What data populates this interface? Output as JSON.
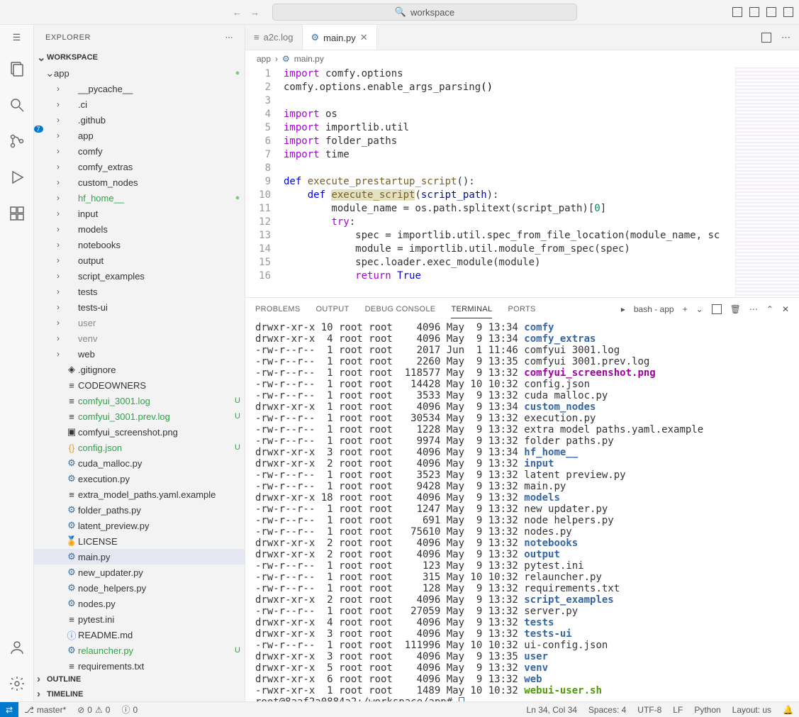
{
  "title": {
    "search_placeholder": "workspace"
  },
  "activity": {
    "badge_scc": "7"
  },
  "sidebar": {
    "title": "EXPLORER",
    "workspace": "WORKSPACE",
    "outline": "OUTLINE",
    "timeline": "TIMELINE",
    "root": "app",
    "items": [
      {
        "type": "folder",
        "name": "__pycache__",
        "indent": 2
      },
      {
        "type": "folder",
        "name": ".ci",
        "indent": 2
      },
      {
        "type": "folder",
        "name": ".github",
        "indent": 2
      },
      {
        "type": "folder",
        "name": "app",
        "indent": 2
      },
      {
        "type": "folder",
        "name": "comfy",
        "indent": 2
      },
      {
        "type": "folder",
        "name": "comfy_extras",
        "indent": 2
      },
      {
        "type": "folder",
        "name": "custom_nodes",
        "indent": 2
      },
      {
        "type": "folder",
        "name": "hf_home__",
        "indent": 2,
        "color": "green",
        "dot": true
      },
      {
        "type": "folder",
        "name": "input",
        "indent": 2
      },
      {
        "type": "folder",
        "name": "models",
        "indent": 2
      },
      {
        "type": "folder",
        "name": "notebooks",
        "indent": 2
      },
      {
        "type": "folder",
        "name": "output",
        "indent": 2
      },
      {
        "type": "folder",
        "name": "script_examples",
        "indent": 2
      },
      {
        "type": "folder",
        "name": "tests",
        "indent": 2
      },
      {
        "type": "folder",
        "name": "tests-ui",
        "indent": 2
      },
      {
        "type": "folder",
        "name": "user",
        "indent": 2,
        "grey": true
      },
      {
        "type": "folder",
        "name": "venv",
        "indent": 2,
        "grey": true
      },
      {
        "type": "folder",
        "name": "web",
        "indent": 2
      },
      {
        "type": "file",
        "name": ".gitignore",
        "indent": 2,
        "icon": "◈"
      },
      {
        "type": "file",
        "name": "CODEOWNERS",
        "indent": 2,
        "icon": "≡"
      },
      {
        "type": "file",
        "name": "comfyui_3001.log",
        "indent": 2,
        "icon": "≡",
        "color": "green",
        "status": "U"
      },
      {
        "type": "file",
        "name": "comfyui_3001.prev.log",
        "indent": 2,
        "icon": "≡",
        "color": "green",
        "status": "U"
      },
      {
        "type": "file",
        "name": "comfyui_screenshot.png",
        "indent": 2,
        "icon": "▣"
      },
      {
        "type": "file",
        "name": "config.json",
        "indent": 2,
        "icon": "{}",
        "iconColor": "orange",
        "color": "green",
        "status": "U"
      },
      {
        "type": "file",
        "name": "cuda_malloc.py",
        "indent": 2,
        "icon": "🐍",
        "py": true
      },
      {
        "type": "file",
        "name": "execution.py",
        "indent": 2,
        "icon": "🐍",
        "py": true
      },
      {
        "type": "file",
        "name": "extra_model_paths.yaml.example",
        "indent": 2,
        "icon": "≡"
      },
      {
        "type": "file",
        "name": "folder_paths.py",
        "indent": 2,
        "icon": "🐍",
        "py": true
      },
      {
        "type": "file",
        "name": "latent_preview.py",
        "indent": 2,
        "icon": "🐍",
        "py": true
      },
      {
        "type": "file",
        "name": "LICENSE",
        "indent": 2,
        "icon": "🏅",
        "iconColor": "orange"
      },
      {
        "type": "file",
        "name": "main.py",
        "indent": 2,
        "icon": "🐍",
        "py": true,
        "selected": true
      },
      {
        "type": "file",
        "name": "new_updater.py",
        "indent": 2,
        "icon": "🐍",
        "py": true
      },
      {
        "type": "file",
        "name": "node_helpers.py",
        "indent": 2,
        "icon": "🐍",
        "py": true
      },
      {
        "type": "file",
        "name": "nodes.py",
        "indent": 2,
        "icon": "🐍",
        "py": true
      },
      {
        "type": "file",
        "name": "pytest.ini",
        "indent": 2,
        "icon": "≡"
      },
      {
        "type": "file",
        "name": "README.md",
        "indent": 2,
        "icon": "ⓘ",
        "iconColor": "blue"
      },
      {
        "type": "file",
        "name": "relauncher.py",
        "indent": 2,
        "icon": "🐍",
        "py": true,
        "color": "green",
        "status": "U"
      },
      {
        "type": "file",
        "name": "requirements.txt",
        "indent": 2,
        "icon": "≡"
      }
    ]
  },
  "tabs": [
    {
      "label": "a2c.log",
      "icon": "≡",
      "active": false
    },
    {
      "label": "main.py",
      "icon": "py",
      "active": true
    }
  ],
  "breadcrumb": {
    "a": "app",
    "b": "main.py"
  },
  "code_lines": [
    {
      "n": 1,
      "html": "<span class='kw'>import</span> comfy.options"
    },
    {
      "n": 2,
      "html": "comfy.options.enable_args_parsing<span class='op'>()</span>"
    },
    {
      "n": 3,
      "html": ""
    },
    {
      "n": 4,
      "html": "<span class='kw'>import</span> os"
    },
    {
      "n": 5,
      "html": "<span class='kw'>import</span> importlib.util"
    },
    {
      "n": 6,
      "html": "<span class='kw'>import</span> folder_paths"
    },
    {
      "n": 7,
      "html": "<span class='kw'>import</span> time"
    },
    {
      "n": 8,
      "html": ""
    },
    {
      "n": 9,
      "html": "<span class='bluekw'>def</span> <span class='fn'>execute_prestartup_script</span>():"
    },
    {
      "n": 10,
      "html": "    <span class='bluekw'>def</span> <span class='fn hl'>execute_script</span>(<span class='id'>script_path</span>):"
    },
    {
      "n": 11,
      "html": "        module_name = os.path.splitext(script_path)[<span class='num'>0</span>]"
    },
    {
      "n": 12,
      "html": "        <span class='kw'>try</span>:"
    },
    {
      "n": 13,
      "html": "            spec = importlib.util.spec_from_file_location(module_name, sc"
    },
    {
      "n": 14,
      "html": "            module = importlib.util.module_from_spec(spec)"
    },
    {
      "n": 15,
      "html": "            spec.loader.exec_module(module)"
    },
    {
      "n": 16,
      "html": "            <span class='kw'>return</span> <span class='bluekw'>True</span>"
    }
  ],
  "panel": {
    "tabs": [
      "PROBLEMS",
      "OUTPUT",
      "DEBUG CONSOLE",
      "TERMINAL",
      "PORTS"
    ],
    "active": "TERMINAL",
    "shell_label": "bash - app",
    "lines": [
      {
        "perm": "drwxr-xr-x",
        "n": "10",
        "o": "root root",
        "sz": "   4096",
        "dt": "May  9 13:34",
        "name": "comfy",
        "cls": "t-dir"
      },
      {
        "perm": "drwxr-xr-x",
        "n": " 4",
        "o": "root root",
        "sz": "   4096",
        "dt": "May  9 13:34",
        "name": "comfy_extras",
        "cls": "t-dir"
      },
      {
        "perm": "-rw-r--r--",
        "n": " 1",
        "o": "root root",
        "sz": "   2017",
        "dt": "Jun  1 11:46",
        "name": "comfyui 3001.log",
        "cls": ""
      },
      {
        "perm": "-rw-r--r--",
        "n": " 1",
        "o": "root root",
        "sz": "   2260",
        "dt": "May  9 13:35",
        "name": "comfyui 3001.prev.log",
        "cls": ""
      },
      {
        "perm": "-rw-r--r--",
        "n": " 1",
        "o": "root root",
        "sz": " 118577",
        "dt": "May  9 13:32",
        "name": "comfyui_screenshot.png",
        "cls": "t-img"
      },
      {
        "perm": "-rw-r--r--",
        "n": " 1",
        "o": "root root",
        "sz": "  14428",
        "dt": "May 10 10:32",
        "name": "config.json",
        "cls": ""
      },
      {
        "perm": "-rw-r--r--",
        "n": " 1",
        "o": "root root",
        "sz": "   3533",
        "dt": "May  9 13:32",
        "name": "cuda malloc.py",
        "cls": ""
      },
      {
        "perm": "drwxr-xr-x",
        "n": " 1",
        "o": "root root",
        "sz": "   4096",
        "dt": "May  9 13:34",
        "name": "custom_nodes",
        "cls": "t-dir"
      },
      {
        "perm": "-rw-r--r--",
        "n": " 1",
        "o": "root root",
        "sz": "  30534",
        "dt": "May  9 13:32",
        "name": "execution.py",
        "cls": ""
      },
      {
        "perm": "-rw-r--r--",
        "n": " 1",
        "o": "root root",
        "sz": "   1228",
        "dt": "May  9 13:32",
        "name": "extra model paths.yaml.example",
        "cls": ""
      },
      {
        "perm": "-rw-r--r--",
        "n": " 1",
        "o": "root root",
        "sz": "   9974",
        "dt": "May  9 13:32",
        "name": "folder paths.py",
        "cls": ""
      },
      {
        "perm": "drwxr-xr-x",
        "n": " 3",
        "o": "root root",
        "sz": "   4096",
        "dt": "May  9 13:34",
        "name": "hf_home__",
        "cls": "t-dir"
      },
      {
        "perm": "drwxr-xr-x",
        "n": " 2",
        "o": "root root",
        "sz": "   4096",
        "dt": "May  9 13:32",
        "name": "input",
        "cls": "t-dir"
      },
      {
        "perm": "-rw-r--r--",
        "n": " 1",
        "o": "root root",
        "sz": "   3523",
        "dt": "May  9 13:32",
        "name": "latent preview.py",
        "cls": ""
      },
      {
        "perm": "-rw-r--r--",
        "n": " 1",
        "o": "root root",
        "sz": "   9428",
        "dt": "May  9 13:32",
        "name": "main.py",
        "cls": ""
      },
      {
        "perm": "drwxr-xr-x",
        "n": "18",
        "o": "root root",
        "sz": "   4096",
        "dt": "May  9 13:32",
        "name": "models",
        "cls": "t-dir"
      },
      {
        "perm": "-rw-r--r--",
        "n": " 1",
        "o": "root root",
        "sz": "   1247",
        "dt": "May  9 13:32",
        "name": "new updater.py",
        "cls": ""
      },
      {
        "perm": "-rw-r--r--",
        "n": " 1",
        "o": "root root",
        "sz": "    691",
        "dt": "May  9 13:32",
        "name": "node helpers.py",
        "cls": ""
      },
      {
        "perm": "-rw-r--r--",
        "n": " 1",
        "o": "root root",
        "sz": "  75610",
        "dt": "May  9 13:32",
        "name": "nodes.py",
        "cls": ""
      },
      {
        "perm": "drwxr-xr-x",
        "n": " 2",
        "o": "root root",
        "sz": "   4096",
        "dt": "May  9 13:32",
        "name": "notebooks",
        "cls": "t-dir"
      },
      {
        "perm": "drwxr-xr-x",
        "n": " 2",
        "o": "root root",
        "sz": "   4096",
        "dt": "May  9 13:32",
        "name": "output",
        "cls": "t-dir"
      },
      {
        "perm": "-rw-r--r--",
        "n": " 1",
        "o": "root root",
        "sz": "    123",
        "dt": "May  9 13:32",
        "name": "pytest.ini",
        "cls": ""
      },
      {
        "perm": "-rw-r--r--",
        "n": " 1",
        "o": "root root",
        "sz": "    315",
        "dt": "May 10 10:32",
        "name": "relauncher.py",
        "cls": ""
      },
      {
        "perm": "-rw-r--r--",
        "n": " 1",
        "o": "root root",
        "sz": "    128",
        "dt": "May  9 13:32",
        "name": "requirements.txt",
        "cls": ""
      },
      {
        "perm": "drwxr-xr-x",
        "n": " 2",
        "o": "root root",
        "sz": "   4096",
        "dt": "May  9 13:32",
        "name": "script_examples",
        "cls": "t-dir"
      },
      {
        "perm": "-rw-r--r--",
        "n": " 1",
        "o": "root root",
        "sz": "  27059",
        "dt": "May  9 13:32",
        "name": "server.py",
        "cls": ""
      },
      {
        "perm": "drwxr-xr-x",
        "n": " 4",
        "o": "root root",
        "sz": "   4096",
        "dt": "May  9 13:32",
        "name": "tests",
        "cls": "t-dir"
      },
      {
        "perm": "drwxr-xr-x",
        "n": " 3",
        "o": "root root",
        "sz": "   4096",
        "dt": "May  9 13:32",
        "name": "tests-ui",
        "cls": "t-dir"
      },
      {
        "perm": "-rw-r--r--",
        "n": " 1",
        "o": "root root",
        "sz": " 111996",
        "dt": "May 10 10:32",
        "name": "ui-config.json",
        "cls": ""
      },
      {
        "perm": "drwxr-xr-x",
        "n": " 3",
        "o": "root root",
        "sz": "   4096",
        "dt": "May  9 13:35",
        "name": "user",
        "cls": "t-dir"
      },
      {
        "perm": "drwxr-xr-x",
        "n": " 5",
        "o": "root root",
        "sz": "   4096",
        "dt": "May  9 13:32",
        "name": "venv",
        "cls": "t-dir"
      },
      {
        "perm": "drwxr-xr-x",
        "n": " 6",
        "o": "root root",
        "sz": "   4096",
        "dt": "May  9 13:32",
        "name": "web",
        "cls": "t-dir"
      },
      {
        "perm": "-rwxr-xr-x",
        "n": " 1",
        "o": "root root",
        "sz": "   1489",
        "dt": "May 10 10:32",
        "name": "webui-user.sh",
        "cls": "t-exe"
      }
    ],
    "prompt": "root@8aaf2a0884a2:/workspace/app# "
  },
  "status": {
    "branch": "master*",
    "errors": "0",
    "warnings": "0",
    "ports": "0",
    "cursor": "Ln 34, Col 34",
    "spaces": "Spaces: 4",
    "encoding": "UTF-8",
    "eol": "LF",
    "lang": "Python",
    "layout": "Layout: us"
  }
}
